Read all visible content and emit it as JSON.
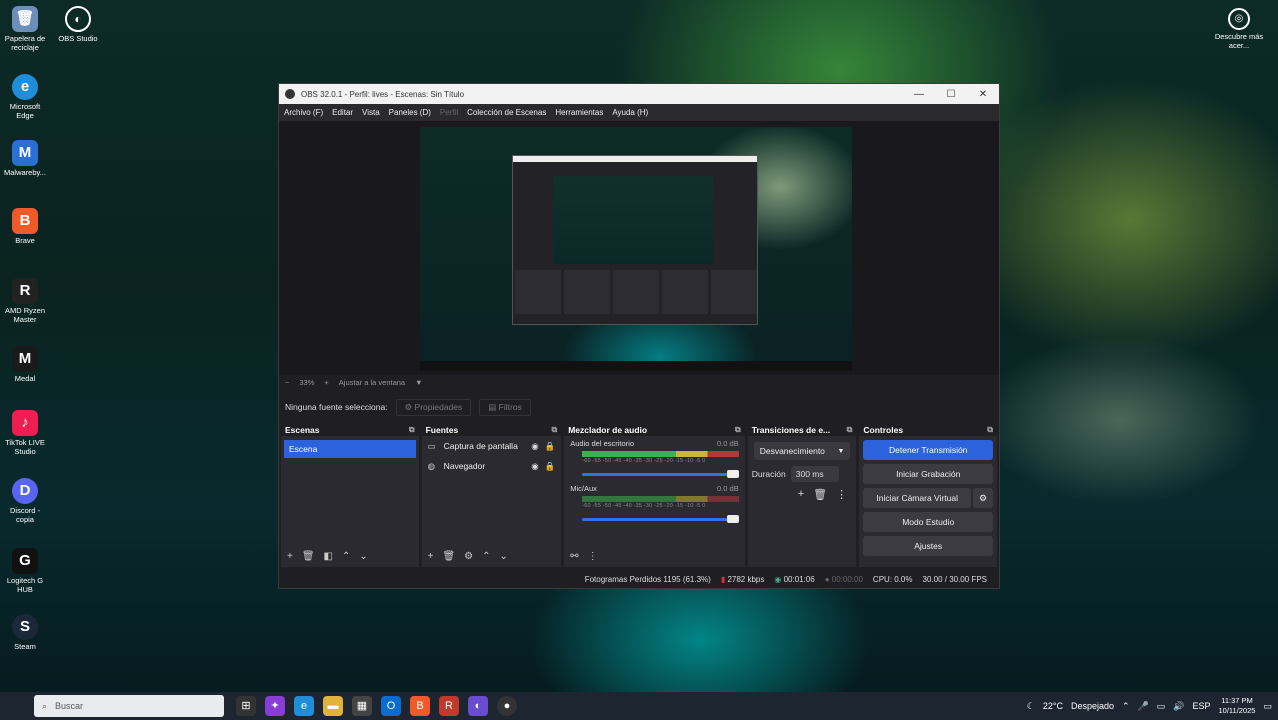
{
  "desktop": {
    "icons": [
      {
        "label": "Papelera de reciclaje",
        "icon": "recycle-bin-icon",
        "color": "#7aa6d8",
        "glyph": "🗑"
      },
      {
        "label": "Microsoft Edge",
        "icon": "edge-icon",
        "color": "#1e8ed8",
        "glyph": "e"
      },
      {
        "label": "Malwareby...",
        "icon": "malwarebytes-icon",
        "color": "#2a6fd6",
        "glyph": "M"
      },
      {
        "label": "Brave",
        "icon": "brave-icon",
        "color": "#f05a28",
        "glyph": "B"
      },
      {
        "label": "AMD Ryzen Master",
        "icon": "ryzen-icon",
        "color": "#222222",
        "glyph": "R"
      },
      {
        "label": "Medal",
        "icon": "medal-icon",
        "color": "#1a1a1a",
        "glyph": "M"
      },
      {
        "label": "TikTok LIVE Studio",
        "icon": "tiktok-icon",
        "color": "#ee1d52",
        "glyph": "♪"
      },
      {
        "label": "Discord - copia",
        "icon": "discord-icon",
        "color": "#5865f2",
        "glyph": "D"
      },
      {
        "label": "Logitech G HUB",
        "icon": "logitech-icon",
        "color": "#111111",
        "glyph": "G"
      },
      {
        "label": "Steam",
        "icon": "steam-icon",
        "color": "#1b2838",
        "glyph": "S"
      }
    ],
    "obs_icon": {
      "label": "OBS Studio",
      "icon": "obs-icon"
    },
    "right_icon": {
      "label": "Descubre más acer...",
      "icon": "discover-icon"
    }
  },
  "window": {
    "title": "OBS 32.0.1 - Perfil: lives - Escenas: Sin Título",
    "controls": [
      "—",
      "☐",
      "✕"
    ],
    "menu": [
      {
        "label": "Archivo (F)",
        "enabled": true
      },
      {
        "label": "Editar",
        "enabled": true
      },
      {
        "label": "Vista",
        "enabled": true
      },
      {
        "label": "Paneles (D)",
        "enabled": true
      },
      {
        "label": "Perfil",
        "enabled": false
      },
      {
        "label": "Colección de Escenas",
        "enabled": true
      },
      {
        "label": "Herramientas",
        "enabled": true
      },
      {
        "label": "Ayuda (H)",
        "enabled": true
      }
    ]
  },
  "zoom": {
    "minus": "−",
    "value": "33%",
    "plus": "+",
    "fit": "Ajustar a la ventana",
    "arrow": "▼"
  },
  "source_bar": {
    "status": "Ninguna fuente selecciona:",
    "properties": "Propiedades",
    "filters": "Filtros"
  },
  "scenes": {
    "title": "Escenas",
    "items": [
      "Escena"
    ]
  },
  "sources": {
    "title": "Fuentes",
    "items": [
      {
        "label": "Captura de pantalla",
        "icon": "monitor-icon"
      },
      {
        "label": "Navegador",
        "icon": "globe-icon"
      }
    ]
  },
  "mixer": {
    "title": "Mezclador de audio",
    "channels": [
      {
        "name": "Audio del escritorio",
        "db": "0.0 dB",
        "level": 1.0
      },
      {
        "name": "Mic/Aux",
        "db": "0.0 dB",
        "level": 1.0
      }
    ],
    "ticks": "-60 -55 -50 -45 -40 -35 -30 -25 -20 -15 -10 -5 0"
  },
  "transitions": {
    "title": "Transiciones de e...",
    "selected": "Desvanecimiento",
    "duration_label": "Duración",
    "duration": "300 ms"
  },
  "controls": {
    "title": "Controles",
    "stop_stream": "Detener Transmisión",
    "start_record": "Iniciar Grabación",
    "virtual_cam": "Iniciar Cámara Virtual",
    "studio_mode": "Modo Estudio",
    "settings": "Ajustes"
  },
  "status": {
    "dropped": "Fotogramas Perdidos 1195 (61.3%)",
    "bitrate": "2782 kbps",
    "live_time": "00:01:06",
    "rec_time": "00:00:00",
    "cpu": "CPU: 0.0%",
    "fps": "30.00 / 30.00 FPS"
  },
  "taskbar": {
    "search_placeholder": "Buscar",
    "weather": "22°C",
    "weather_text": "Despejado",
    "lang": "ESP",
    "time": "11:37 PM",
    "date": "10/11/2025"
  }
}
